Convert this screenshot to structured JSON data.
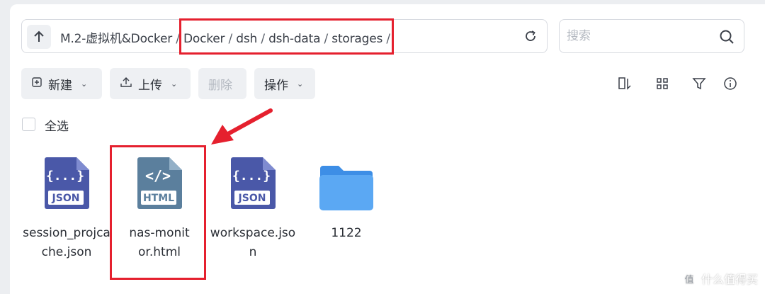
{
  "path_bar": {
    "segments": [
      "M.2-虚拟机&Docker",
      "Docker",
      "dsh",
      "dsh-data",
      "storages"
    ],
    "separator": "/"
  },
  "search": {
    "placeholder": "搜索"
  },
  "toolbar": {
    "new_label": "新建",
    "upload_label": "上传",
    "delete_label": "删除",
    "actions_label": "操作"
  },
  "select_all_label": "全选",
  "files": [
    {
      "name": "session_projcache.json",
      "type": "json",
      "badge": "JSON",
      "glyph": "{...}"
    },
    {
      "name": "nas-monitor.html",
      "type": "html",
      "badge": "HTML",
      "glyph": "</>"
    },
    {
      "name": "workspace.json",
      "type": "json",
      "badge": "JSON",
      "glyph": "{...}"
    },
    {
      "name": "1122",
      "type": "folder"
    }
  ],
  "colors": {
    "annotation_red": "#e5202e",
    "json_icon": "#4a58a8",
    "html_icon": "#5b7f9d",
    "folder": "#4f9ef0"
  },
  "watermark": {
    "text": "什么值得买",
    "glyph": "值"
  }
}
